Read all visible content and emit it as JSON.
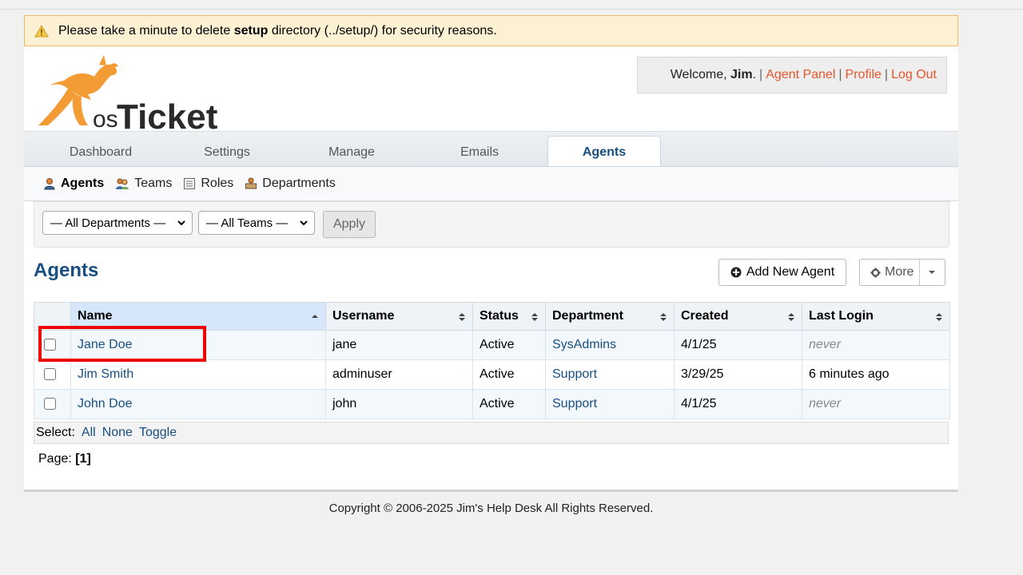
{
  "warning": {
    "pre": "Please take a minute to delete ",
    "bold": "setup",
    "post": " directory (../setup/) for security reasons."
  },
  "logo": {
    "text": "osTicket"
  },
  "welcome": {
    "prefix": "Welcome, ",
    "user": "Jim",
    "suffix": ".",
    "links": [
      "Agent Panel",
      "Profile",
      "Log Out"
    ]
  },
  "nav": {
    "tabs": [
      "Dashboard",
      "Settings",
      "Manage",
      "Emails",
      "Agents"
    ],
    "active": "Agents"
  },
  "subnav": {
    "items": [
      "Agents",
      "Teams",
      "Roles",
      "Departments"
    ],
    "active": "Agents"
  },
  "filters": {
    "department": "— All Departments —",
    "team": "— All Teams —",
    "apply_label": "Apply"
  },
  "page": {
    "title": "Agents",
    "add_button": "Add New Agent",
    "more_button": "More"
  },
  "table": {
    "columns": [
      "Name",
      "Username",
      "Status",
      "Department",
      "Created",
      "Last Login"
    ],
    "rows": [
      {
        "name": "Jane Doe",
        "username": "jane",
        "status": "Active",
        "department": "SysAdmins",
        "created": "4/1/25",
        "last_login": "never"
      },
      {
        "name": "Jim Smith",
        "username": "adminuser",
        "status": "Active",
        "department": "Support",
        "created": "3/29/25",
        "last_login": "6 minutes ago"
      },
      {
        "name": "John Doe",
        "username": "john",
        "status": "Active",
        "department": "Support",
        "created": "4/1/25",
        "last_login": "never"
      }
    ]
  },
  "select_bar": {
    "label": "Select:",
    "all": "All",
    "none": "None",
    "toggle": "Toggle"
  },
  "pagination": {
    "label": "Page:",
    "current": "[1]"
  },
  "footer": {
    "text": "Copyright © 2006-2025 Jim's Help Desk All Rights Reserved."
  },
  "colors": {
    "accent": "#184e81",
    "link_orange": "#e4562b",
    "highlight": "#e00000",
    "warning_bg": "#fdf1d3"
  }
}
